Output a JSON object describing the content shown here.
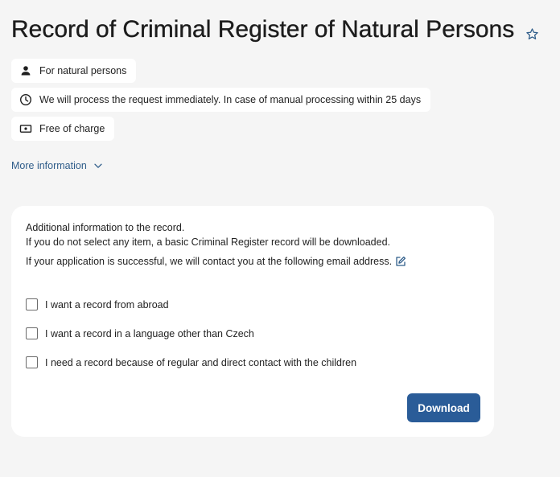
{
  "header": {
    "title": "Record of Criminal Register of Natural Persons"
  },
  "chips": [
    {
      "icon": "person-icon",
      "label": "For natural persons"
    },
    {
      "icon": "clock-icon",
      "label": "We will process the request immediately. In case of manual processing within 25 days"
    },
    {
      "icon": "money-icon",
      "label": "Free of charge"
    }
  ],
  "more_info": {
    "label": "More information"
  },
  "card": {
    "line_1": "Additional information to the record.",
    "line_2": "If you do not select any item, a basic Criminal Register record will be downloaded.",
    "line_3": "If your application is successful, we will contact you at the following email address.",
    "options": [
      {
        "label": "I want a record from abroad",
        "checked": false
      },
      {
        "label": "I want a record in a language other than Czech",
        "checked": false
      },
      {
        "label": "I need a record because of regular and direct contact with the children",
        "checked": false
      }
    ],
    "download_label": "Download"
  },
  "colors": {
    "accent": "#2a5c98",
    "link": "#2f5d8a",
    "background": "#f5f5f5",
    "surface": "#ffffff"
  }
}
